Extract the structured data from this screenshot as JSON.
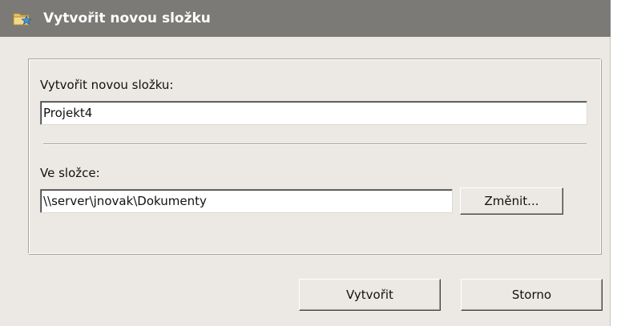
{
  "window": {
    "title": "Vytvořit novou složku",
    "icon": "new-folder-star-icon"
  },
  "form": {
    "new_folder_label": "Vytvořit novou složku:",
    "new_folder_value": "Projekt4",
    "location_label": "Ve složce:",
    "location_value": "\\\\server\\jnovak\\Dokumenty",
    "change_button_label": "Změnit..."
  },
  "actions": {
    "create_label": "Vytvořit",
    "cancel_label": "Storno"
  },
  "colors": {
    "titlebar": "#7c7a76",
    "dialog_background": "#ece9e4",
    "title_text": "#ffffff"
  }
}
